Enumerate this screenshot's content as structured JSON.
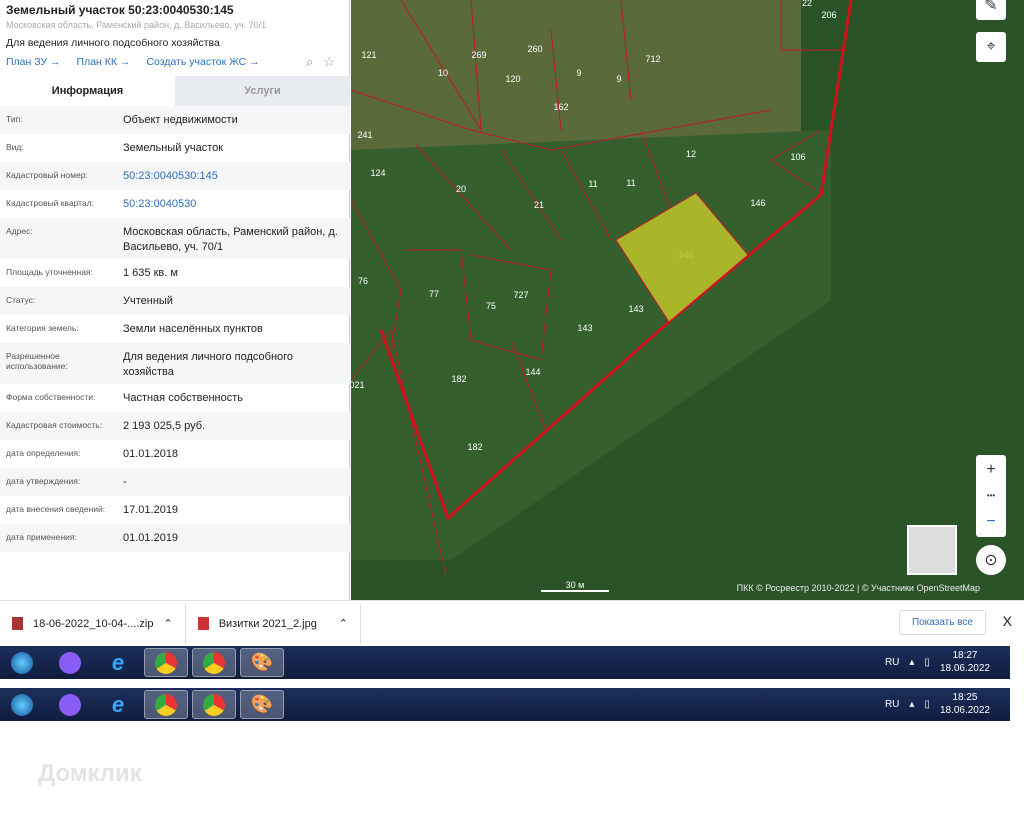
{
  "panel": {
    "title": "Земельный участок 50:23:0040530:145",
    "address": "Московская область, Раменский район, д. Васильево, уч. 70/1",
    "use": "Для ведения личного подсобного хозяйства",
    "links": [
      "План ЗУ →",
      "План КК →",
      "Создать участок ЖС →"
    ],
    "tabs": [
      "Информация",
      "Услуги"
    ],
    "rows": [
      {
        "k": "Тип:",
        "v": "Объект недвижимости"
      },
      {
        "k": "Вид:",
        "v": "Земельный участок"
      },
      {
        "k": "Кадастровый номер:",
        "v": "50:23:0040530:145",
        "link": true
      },
      {
        "k": "Кадастровый квартал:",
        "v": "50:23:0040530",
        "link": true
      },
      {
        "k": "Адрес:",
        "v": "Московская область, Раменский район, д. Васильево, уч. 70/1"
      },
      {
        "k": "Площадь уточненная:",
        "v": "1 635 кв. м"
      },
      {
        "k": "Статус:",
        "v": "Учтенный"
      },
      {
        "k": "Категория земель:",
        "v": "Земли населённых пунктов"
      },
      {
        "k": "Разрешенное использование:",
        "v": "Для ведения личного подсобного хозяйства"
      },
      {
        "k": "Форма собственности:",
        "v": "Частная собственность"
      },
      {
        "k": "Кадастровая стоимость:",
        "v": "2 193 025,5 руб."
      },
      {
        "k": "дата определения:",
        "v": "01.01.2018"
      },
      {
        "k": "дата утверждения:",
        "v": "-"
      },
      {
        "k": "дата внесения сведений:",
        "v": "17.01.2019"
      },
      {
        "k": "дата применения:",
        "v": "01.01.2019"
      }
    ]
  },
  "map": {
    "labels": [
      "121",
      "10",
      "269",
      "120",
      "260",
      "9",
      "162",
      "9",
      "712",
      "22",
      "206",
      "241",
      "124",
      "20",
      "21",
      "11",
      "11",
      "12",
      "106",
      "146",
      "145",
      "76",
      "77",
      "75",
      "727",
      "143",
      "143",
      "182",
      "144",
      "182",
      "021"
    ],
    "scale": "30 м",
    "attribution": "ПКК © Росреестр 2010-2022 | © Участники OpenStreetMap",
    "zoom_in": "+",
    "more": "•••",
    "zoom_out": "−"
  },
  "downloads": {
    "items": [
      "18-06-2022_10-04-....zip",
      "Визитки 2021_2.jpg"
    ],
    "show_all": "Показать все",
    "close": "X"
  },
  "taskbars": [
    {
      "lang": "RU",
      "time": "18:27",
      "date": "18.06.2022"
    },
    {
      "lang": "RU",
      "time": "18:25",
      "date": "18.06.2022"
    }
  ],
  "watermark": "Домклик"
}
